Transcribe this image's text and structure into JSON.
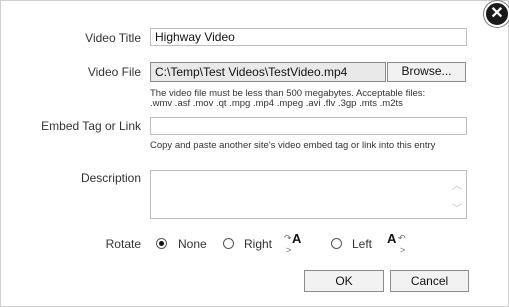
{
  "dialog": {
    "close_icon": "close-icon",
    "close_glyph": "✕"
  },
  "form": {
    "video_title": {
      "label": "Video Title",
      "value": "Highway Video"
    },
    "video_file": {
      "label": "Video File",
      "path": "C:\\Temp\\Test Videos\\TestVideo.mp4",
      "browse_label": "Browse...",
      "hint_line1": "The video file must be less than 500 megabytes. Acceptable files:",
      "hint_line2": ".wmv .asf .mov .qt .mpg .mp4 .mpeg .avi .flv .3gp .mts .m2ts"
    },
    "embed": {
      "label": "Embed Tag or Link",
      "value": "",
      "hint": "Copy and paste another site's video embed tag or link into this entry"
    },
    "description": {
      "label": "Description",
      "value": ""
    },
    "rotate": {
      "label": "Rotate",
      "options": [
        {
          "label": "None",
          "checked": true
        },
        {
          "label": "Right",
          "checked": false
        },
        {
          "label": "Left",
          "checked": false
        }
      ],
      "right_icon_glyph": "A",
      "left_icon_glyph": "A"
    }
  },
  "buttons": {
    "ok": "OK",
    "cancel": "Cancel"
  },
  "colors": {
    "dialog_bg": "#ffffff",
    "backdrop": "#3a3a3a",
    "file_field_bg": "#e9e9e9"
  }
}
